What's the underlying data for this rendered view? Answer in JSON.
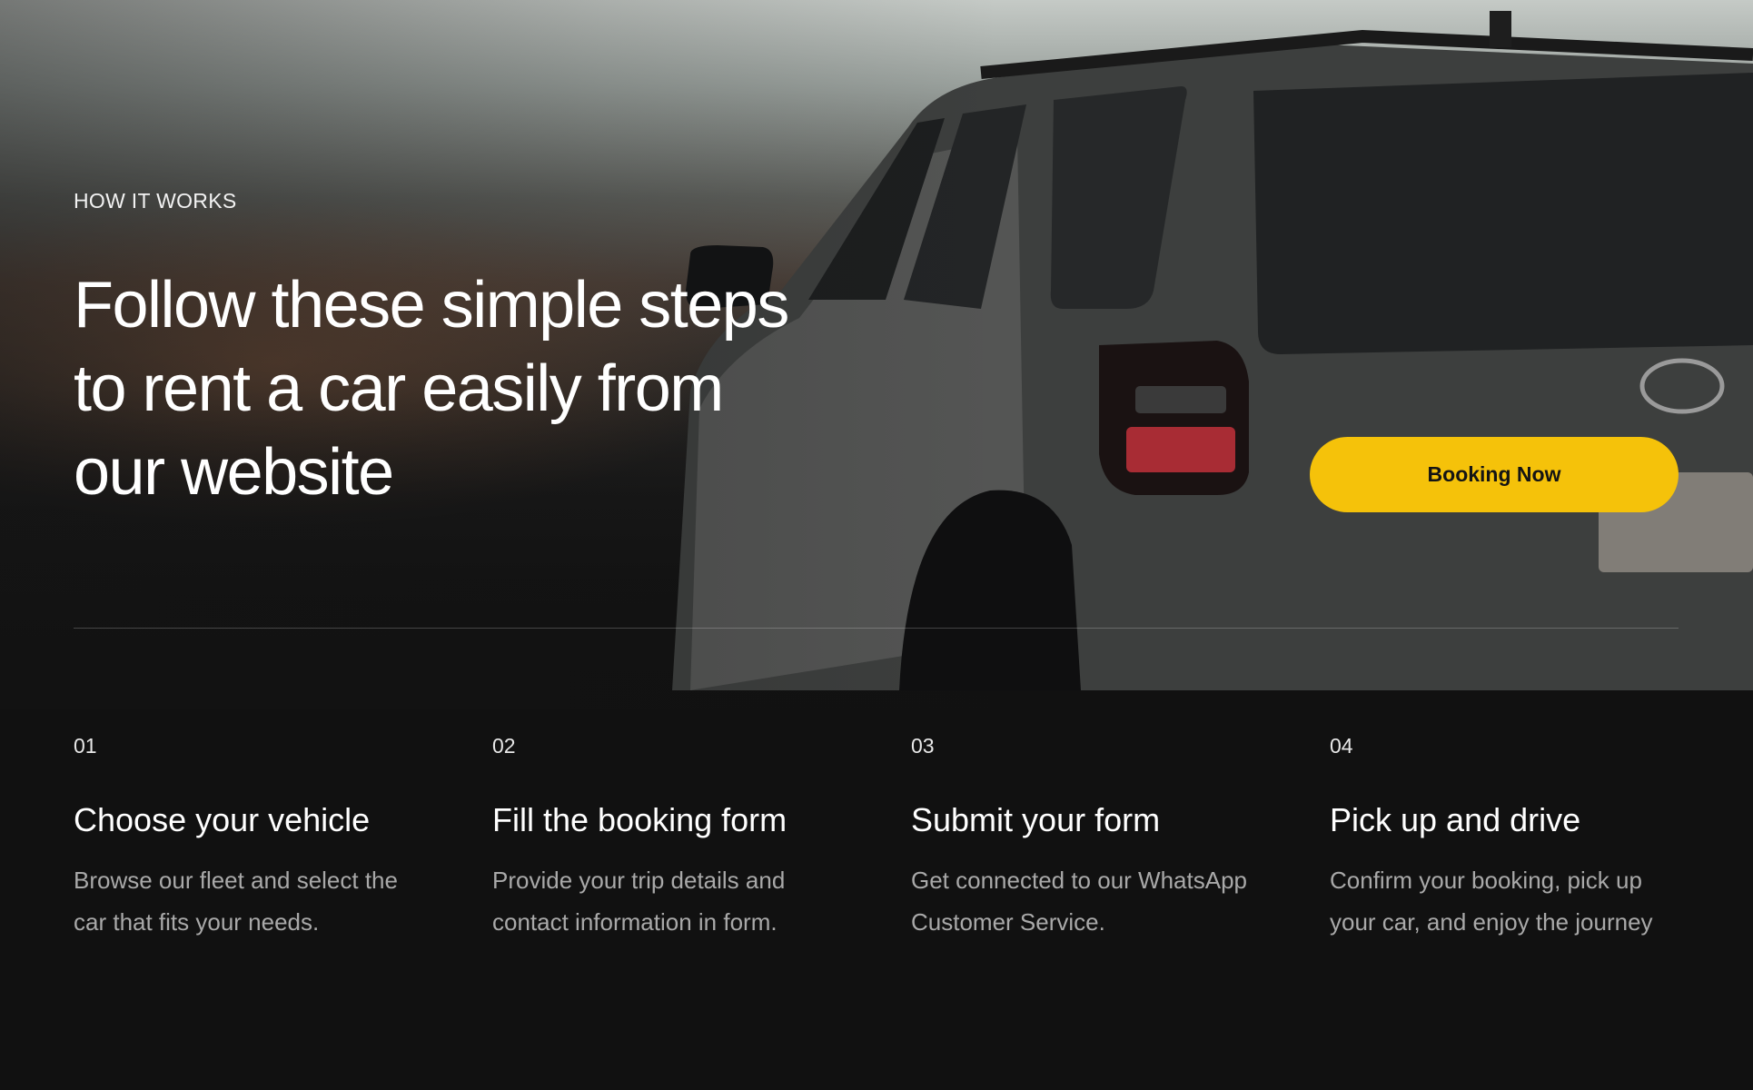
{
  "hero": {
    "eyebrow": "HOW IT WORKS",
    "headline": "Follow these simple steps to rent a car easily from our website",
    "cta_label": "Booking Now"
  },
  "steps": [
    {
      "number": "01",
      "title": "Choose your vehicle",
      "description": "Browse our fleet and select the car that fits your needs."
    },
    {
      "number": "02",
      "title": "Fill the booking form",
      "description": "Provide your trip details and contact information in form."
    },
    {
      "number": "03",
      "title": "Submit your form",
      "description": "Get connected to our WhatsApp Customer Service."
    },
    {
      "number": "04",
      "title": "Pick up and drive",
      "description": "Confirm your booking, pick up your car, and enjoy the journey"
    }
  ],
  "colors": {
    "accent": "#f5c20a",
    "background": "#111111",
    "muted_text": "#a9a9a9"
  }
}
